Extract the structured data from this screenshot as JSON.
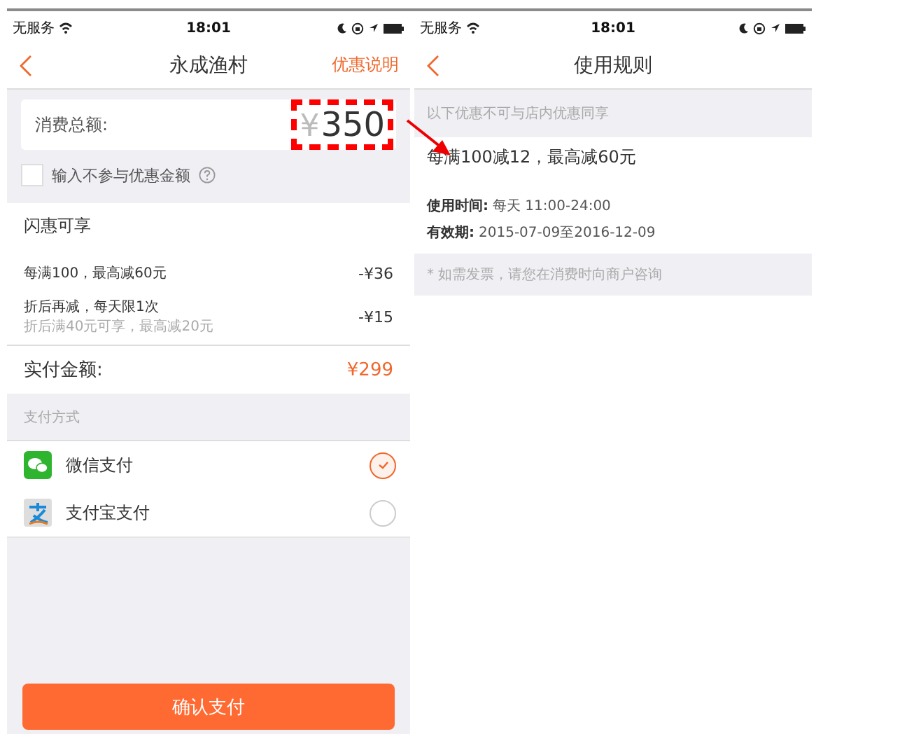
{
  "screens": [
    {
      "status_bar": {
        "carrier": "无服务",
        "time": "18:01"
      },
      "nav": {
        "title": "永成渔村",
        "action": "优惠说明"
      },
      "amount": {
        "label": "消费总额:",
        "currency": "¥",
        "value": "350"
      },
      "exclude": {
        "label": "输入不参与优惠金额",
        "checked": false
      },
      "offers": {
        "title": "闪惠可享",
        "items": [
          {
            "text": "每满100，最高减60元",
            "amount": "-¥36"
          },
          {
            "text": "折后再减，每天限1次",
            "note": "折后满40元可享，最高减20元",
            "amount": "-¥15"
          }
        ]
      },
      "total": {
        "label": "实付金额:",
        "value": "¥299"
      },
      "payment": {
        "header": "支付方式",
        "methods": [
          {
            "kind": "wechat",
            "label": "微信支付",
            "selected": true
          },
          {
            "kind": "alipay",
            "label": "支付宝支付",
            "selected": false
          }
        ]
      },
      "confirm": "确认支付"
    },
    {
      "status_bar": {
        "carrier": "无服务",
        "time": "18:01"
      },
      "nav": {
        "title": "使用规则"
      },
      "notice": "以下优惠不可与店内优惠同享",
      "rule": {
        "title": "每满100减12，最高减60元",
        "lines": [
          {
            "label": "使用时间:",
            "value": "每天 11:00-24:00"
          },
          {
            "label": "有效期:",
            "value": "2015-07-09至2016-12-09"
          }
        ]
      },
      "footnote": "* 如需发票，请您在消费时向商户咨询"
    }
  ]
}
